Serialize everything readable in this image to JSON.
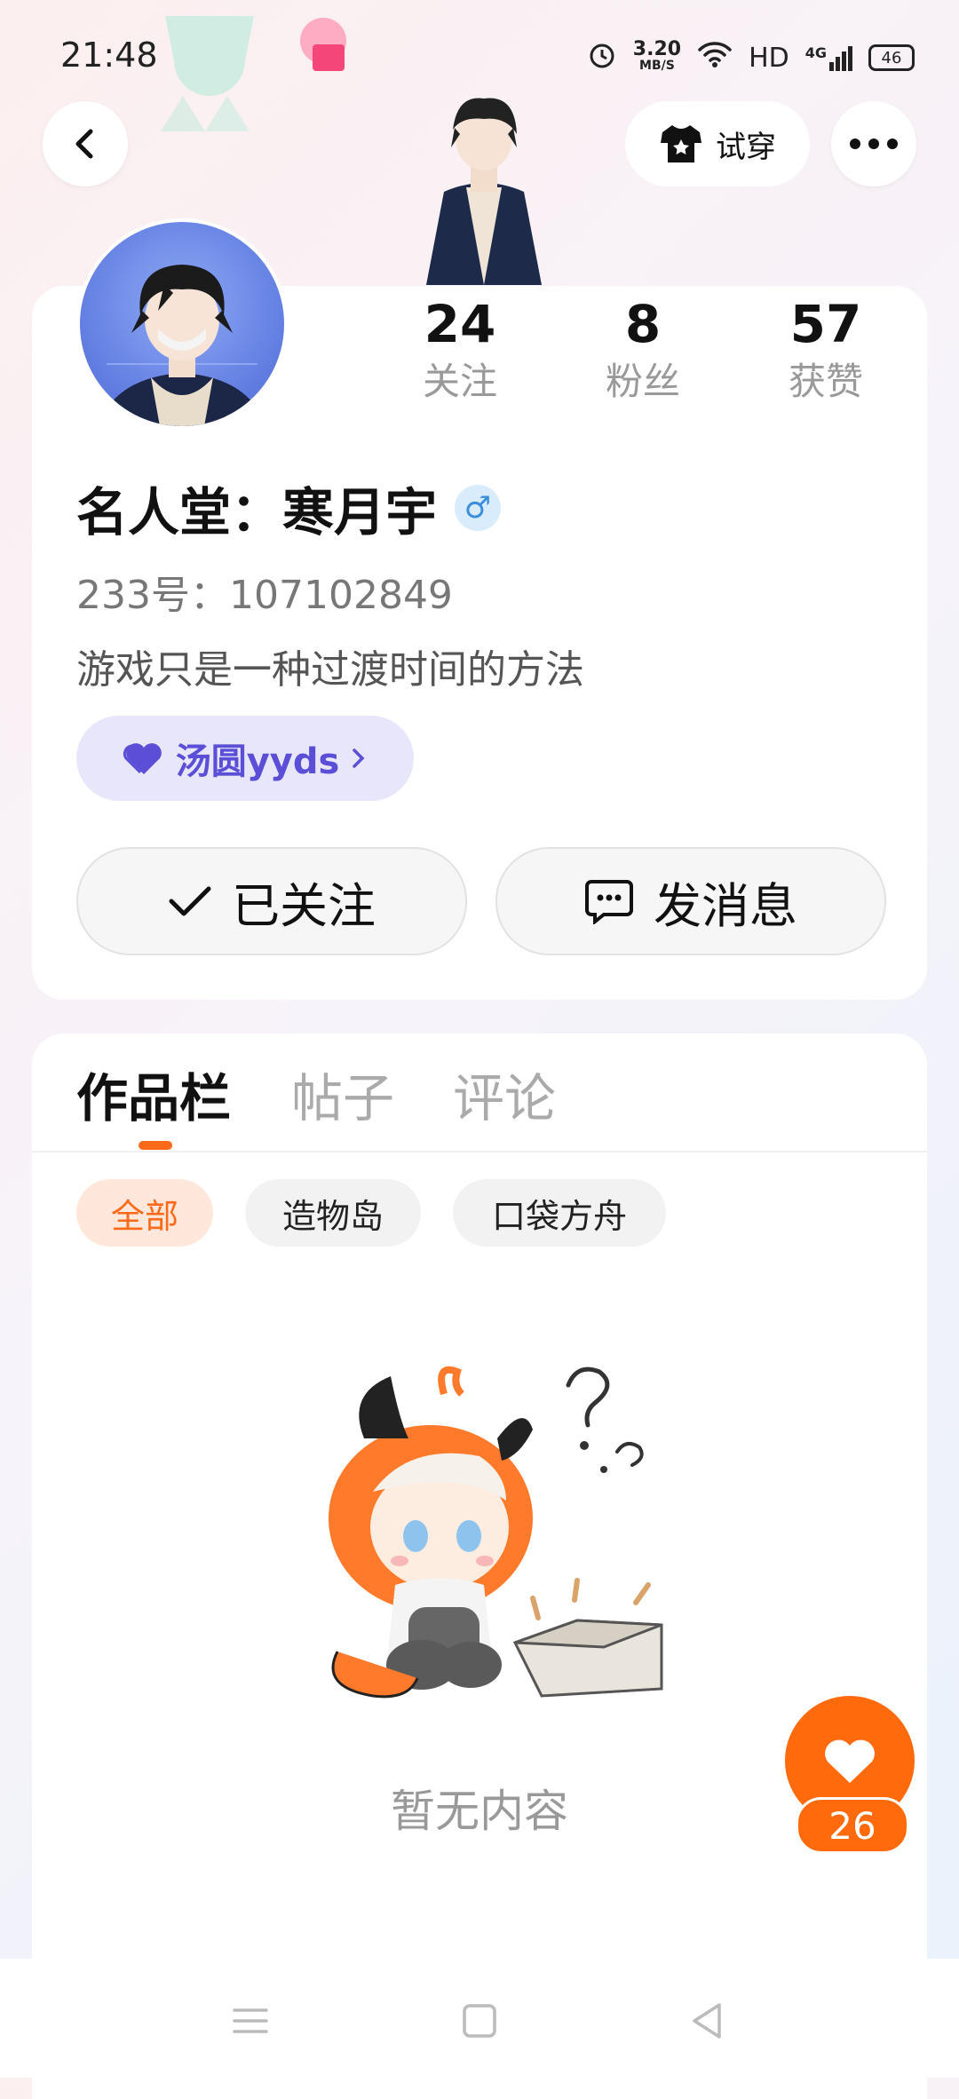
{
  "status_bar": {
    "time": "21:48",
    "net_speed": "3.20",
    "net_unit": "MB/S",
    "hd": "HD",
    "signal": "4G",
    "battery": "46"
  },
  "top_bar": {
    "try_on_label": "试穿"
  },
  "profile": {
    "stats": [
      {
        "num": "24",
        "label": "关注"
      },
      {
        "num": "8",
        "label": "粉丝"
      },
      {
        "num": "57",
        "label": "获赞"
      }
    ],
    "name": "名人堂：寒月宇",
    "gender_symbol": "♂",
    "uid": "233号：107102849",
    "bio": "游戏只是一种过渡时间的方法",
    "tag_label": "汤圆yyds",
    "followed_label": "已关注",
    "message_label": "发消息"
  },
  "works": {
    "tabs": [
      "作品栏",
      "帖子",
      "评论"
    ],
    "chips": [
      "全部",
      "造物岛",
      "口袋方舟"
    ],
    "empty_text": "暂无内容"
  },
  "like_fab": {
    "count": "26"
  },
  "colors": {
    "accent": "#ff6a0d",
    "tag_bg": "#e8e6fb",
    "tag_text": "#5a4fd6"
  }
}
